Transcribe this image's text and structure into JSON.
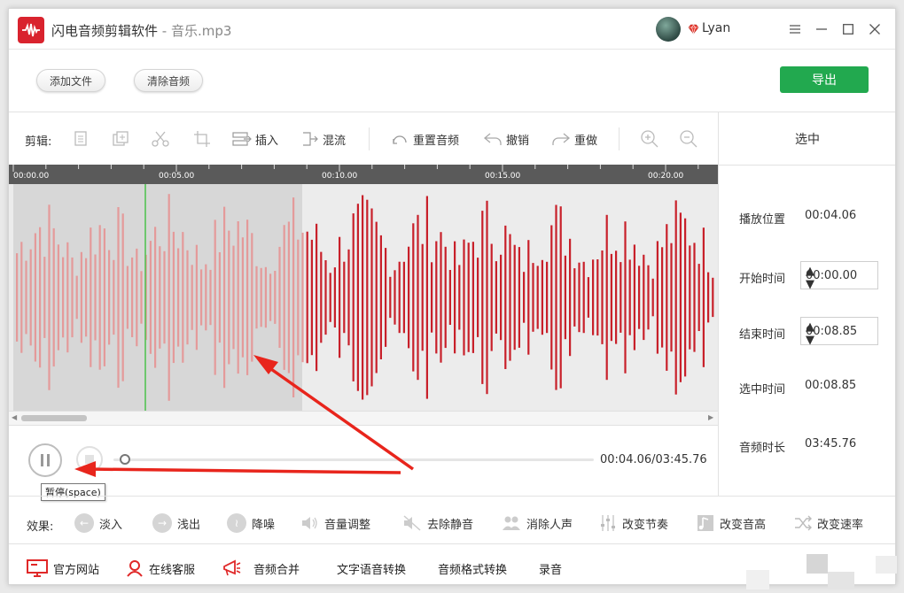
{
  "app": {
    "name": "闪电音频剪辑软件",
    "separator": " - ",
    "file": "音乐.mp3",
    "user": "Lyan"
  },
  "toolbar": {
    "add_file": "添加文件",
    "clear_audio": "清除音频",
    "export": "导出"
  },
  "edit": {
    "label": "剪辑:",
    "insert": "插入",
    "mix": "混流",
    "reset_audio": "重置音频",
    "undo": "撤销",
    "redo": "重做"
  },
  "panel": {
    "header": "选中",
    "play_pos_label": "播放位置",
    "play_pos": "00:04.06",
    "start_label": "开始时间",
    "start": "00:00.00",
    "end_label": "结束时间",
    "end": "00:08.85",
    "sel_label": "选中时间",
    "sel": "00:08.85",
    "duration_label": "音频时长",
    "duration": "03:45.76"
  },
  "timeline": {
    "ticks": [
      "00:00.00",
      "00:05.00",
      "00:10.00",
      "00:15.00",
      "00:20.00"
    ]
  },
  "player": {
    "time": "00:04.06/03:45.76",
    "tooltip": "暂停(space)",
    "progress": 0.018
  },
  "effects": {
    "label": "效果:",
    "fade_in": "淡入",
    "fade_out": "浅出",
    "denoise": "降噪",
    "volume": "音量调整",
    "remove_silence": "去除静音",
    "remove_vocal": "消除人声",
    "tempo": "改变节奏",
    "pitch": "改变音高",
    "speed": "改变速率"
  },
  "bottom": {
    "website": "官方网站",
    "support": "在线客服",
    "merge": "音频合并",
    "tts": "文字语音转换",
    "convert": "音频格式转换",
    "record": "录音"
  },
  "colors": {
    "wave": "#c8202a",
    "wave_selected": "#e49a9a",
    "export": "#22a94f",
    "playhead": "#4cc24c",
    "arrow": "#e8251c"
  }
}
